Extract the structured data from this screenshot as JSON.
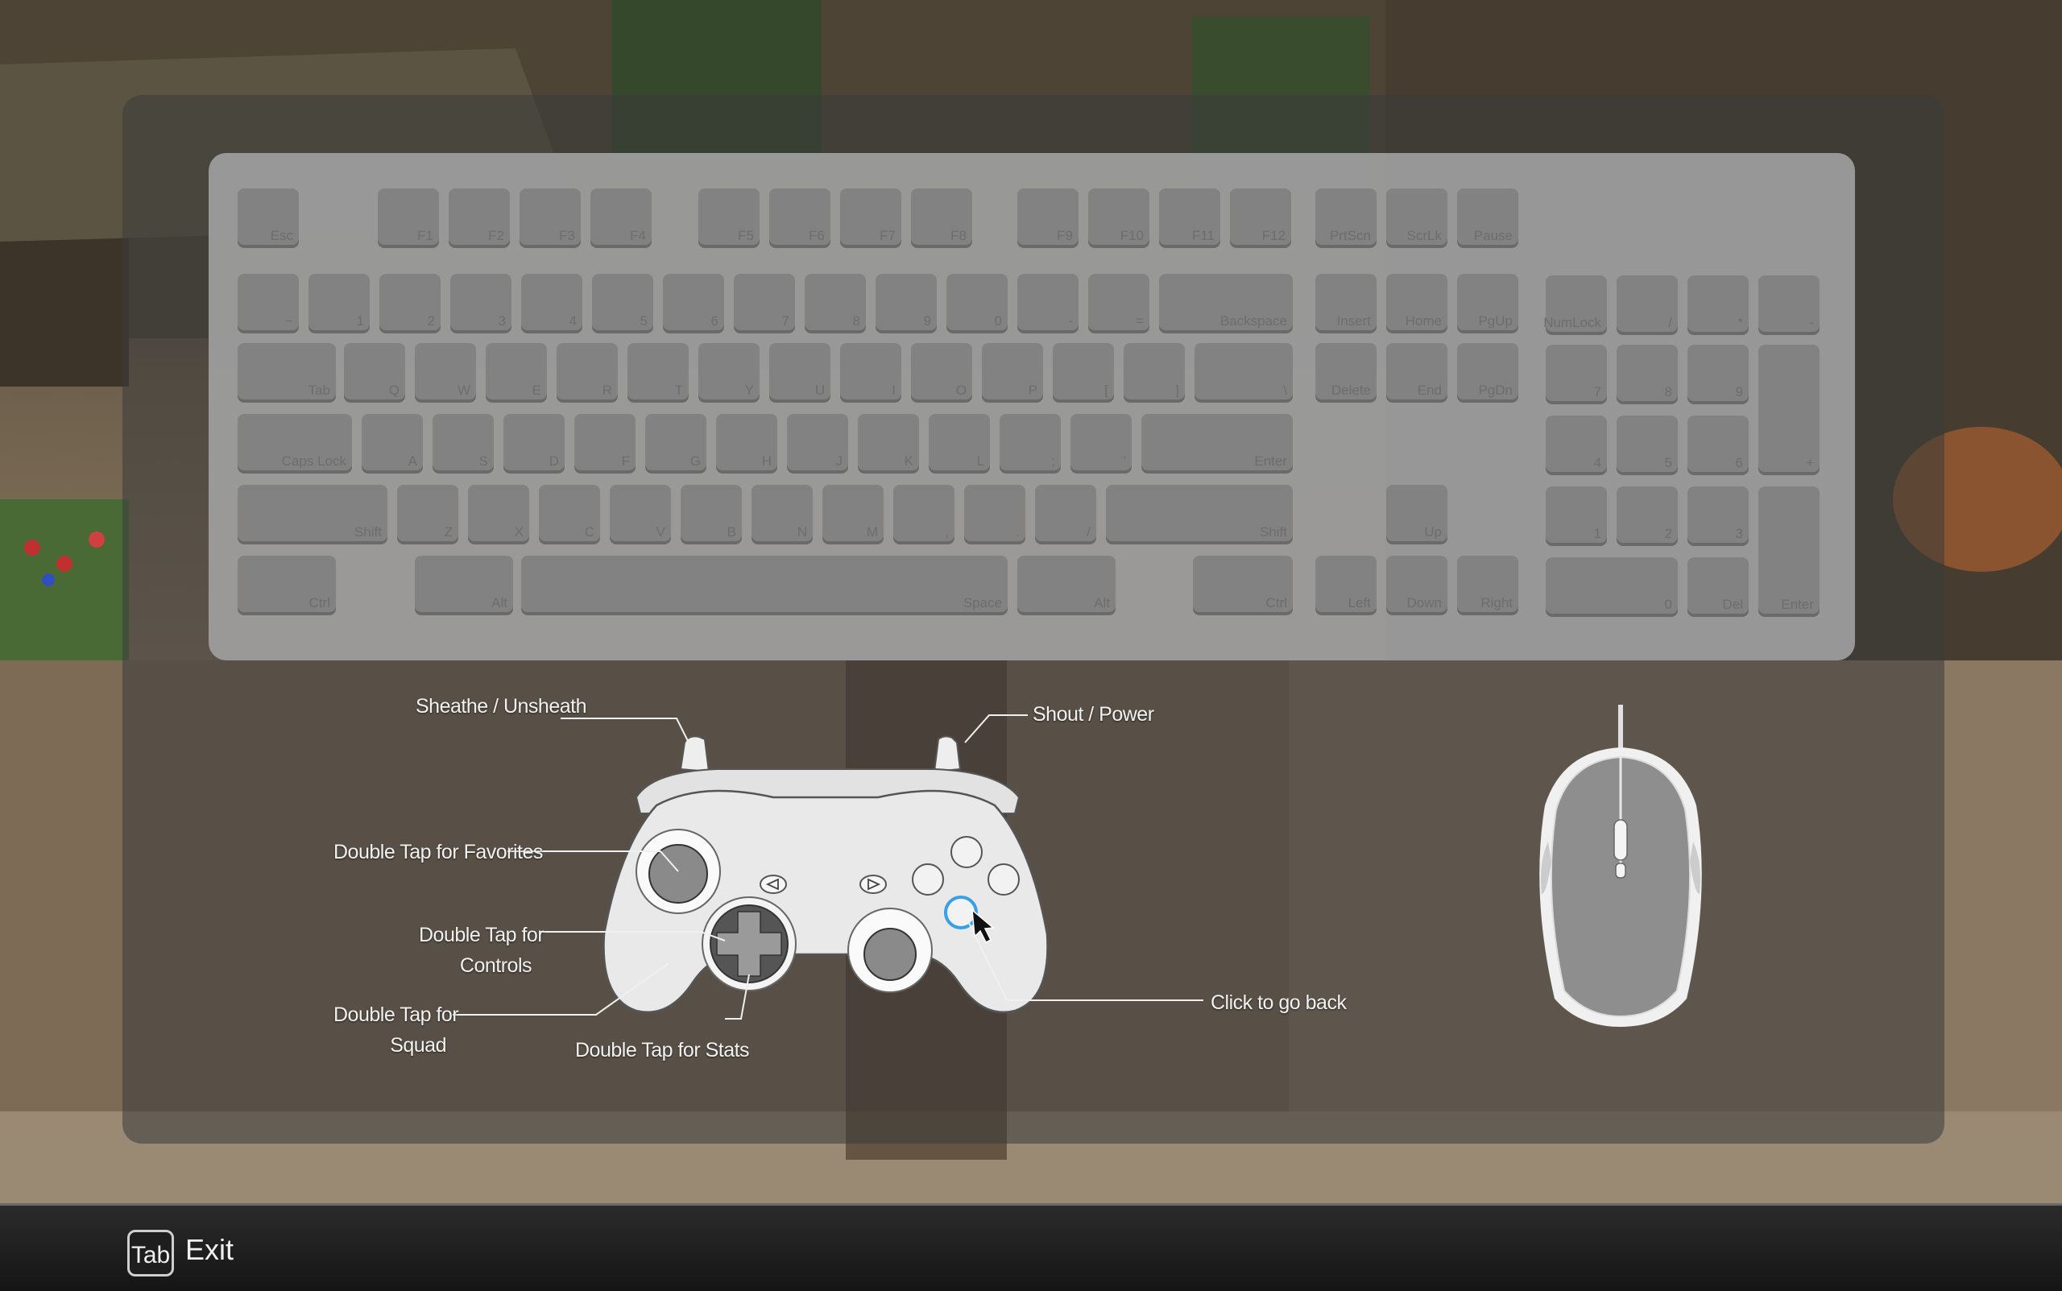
{
  "keyboard": {
    "keys": [
      {
        "label": "Esc"
      },
      {
        "label": "F1"
      },
      {
        "label": "F2"
      },
      {
        "label": "F3"
      },
      {
        "label": "F4"
      },
      {
        "label": "F5"
      },
      {
        "label": "F6"
      },
      {
        "label": "F7"
      },
      {
        "label": "F8"
      },
      {
        "label": "F9"
      },
      {
        "label": "F10"
      },
      {
        "label": "F11"
      },
      {
        "label": "F12"
      },
      {
        "label": "PrtScn"
      },
      {
        "label": "ScrLk"
      },
      {
        "label": "Pause"
      },
      {
        "label": "~"
      },
      {
        "label": "1"
      },
      {
        "label": "2"
      },
      {
        "label": "3"
      },
      {
        "label": "4"
      },
      {
        "label": "5"
      },
      {
        "label": "6"
      },
      {
        "label": "7"
      },
      {
        "label": "8"
      },
      {
        "label": "9"
      },
      {
        "label": "0"
      },
      {
        "label": "-"
      },
      {
        "label": "="
      },
      {
        "label": "Backspace"
      },
      {
        "label": "Insert"
      },
      {
        "label": "Home"
      },
      {
        "label": "PgUp"
      },
      {
        "label": "NumLock"
      },
      {
        "label": "/"
      },
      {
        "label": "*"
      },
      {
        "label": "-"
      },
      {
        "label": "Tab"
      },
      {
        "label": "Q"
      },
      {
        "label": "W"
      },
      {
        "label": "E"
      },
      {
        "label": "R"
      },
      {
        "label": "T"
      },
      {
        "label": "Y"
      },
      {
        "label": "U"
      },
      {
        "label": "I"
      },
      {
        "label": "O"
      },
      {
        "label": "P"
      },
      {
        "label": "["
      },
      {
        "label": "]"
      },
      {
        "label": "\\"
      },
      {
        "label": "Delete"
      },
      {
        "label": "End"
      },
      {
        "label": "PgDn"
      },
      {
        "label": "7"
      },
      {
        "label": "8"
      },
      {
        "label": "9"
      },
      {
        "label": "+"
      },
      {
        "label": "Caps Lock"
      },
      {
        "label": "A"
      },
      {
        "label": "S"
      },
      {
        "label": "D"
      },
      {
        "label": "F"
      },
      {
        "label": "G"
      },
      {
        "label": "H"
      },
      {
        "label": "J"
      },
      {
        "label": "K"
      },
      {
        "label": "L"
      },
      {
        "label": ";"
      },
      {
        "label": "'"
      },
      {
        "label": "Enter"
      },
      {
        "label": "4"
      },
      {
        "label": "5"
      },
      {
        "label": "6"
      },
      {
        "label": "Shift"
      },
      {
        "label": "Z"
      },
      {
        "label": "X"
      },
      {
        "label": "C"
      },
      {
        "label": "V"
      },
      {
        "label": "B"
      },
      {
        "label": "N"
      },
      {
        "label": "M"
      },
      {
        "label": ","
      },
      {
        "label": "."
      },
      {
        "label": "/"
      },
      {
        "label": "Shift"
      },
      {
        "label": "Up"
      },
      {
        "label": "1"
      },
      {
        "label": "2"
      },
      {
        "label": "3"
      },
      {
        "label": "Enter"
      },
      {
        "label": "Ctrl"
      },
      {
        "label": "Alt"
      },
      {
        "label": "Space"
      },
      {
        "label": "Alt"
      },
      {
        "label": "Ctrl"
      },
      {
        "label": "Left"
      },
      {
        "label": "Down"
      },
      {
        "label": "Right"
      },
      {
        "label": "0"
      },
      {
        "label": "Del"
      }
    ]
  },
  "controller_labels": {
    "sheathe": "Sheathe / Unsheath",
    "shout": "Shout / Power",
    "favorites": "Double Tap for Favorites",
    "controls_1": "Double Tap for",
    "controls_2": "Controls",
    "squad_1": "Double Tap for",
    "squad_2": "Squad",
    "stats": "Double Tap for Stats",
    "back": "Click to go back"
  },
  "footer": {
    "key": "Tab",
    "label": "Exit"
  },
  "colors": {
    "panel": "#3a3a3a",
    "keyboard": "#a0a0a0",
    "key": "#828282",
    "highlight": "#3aa0e6"
  }
}
